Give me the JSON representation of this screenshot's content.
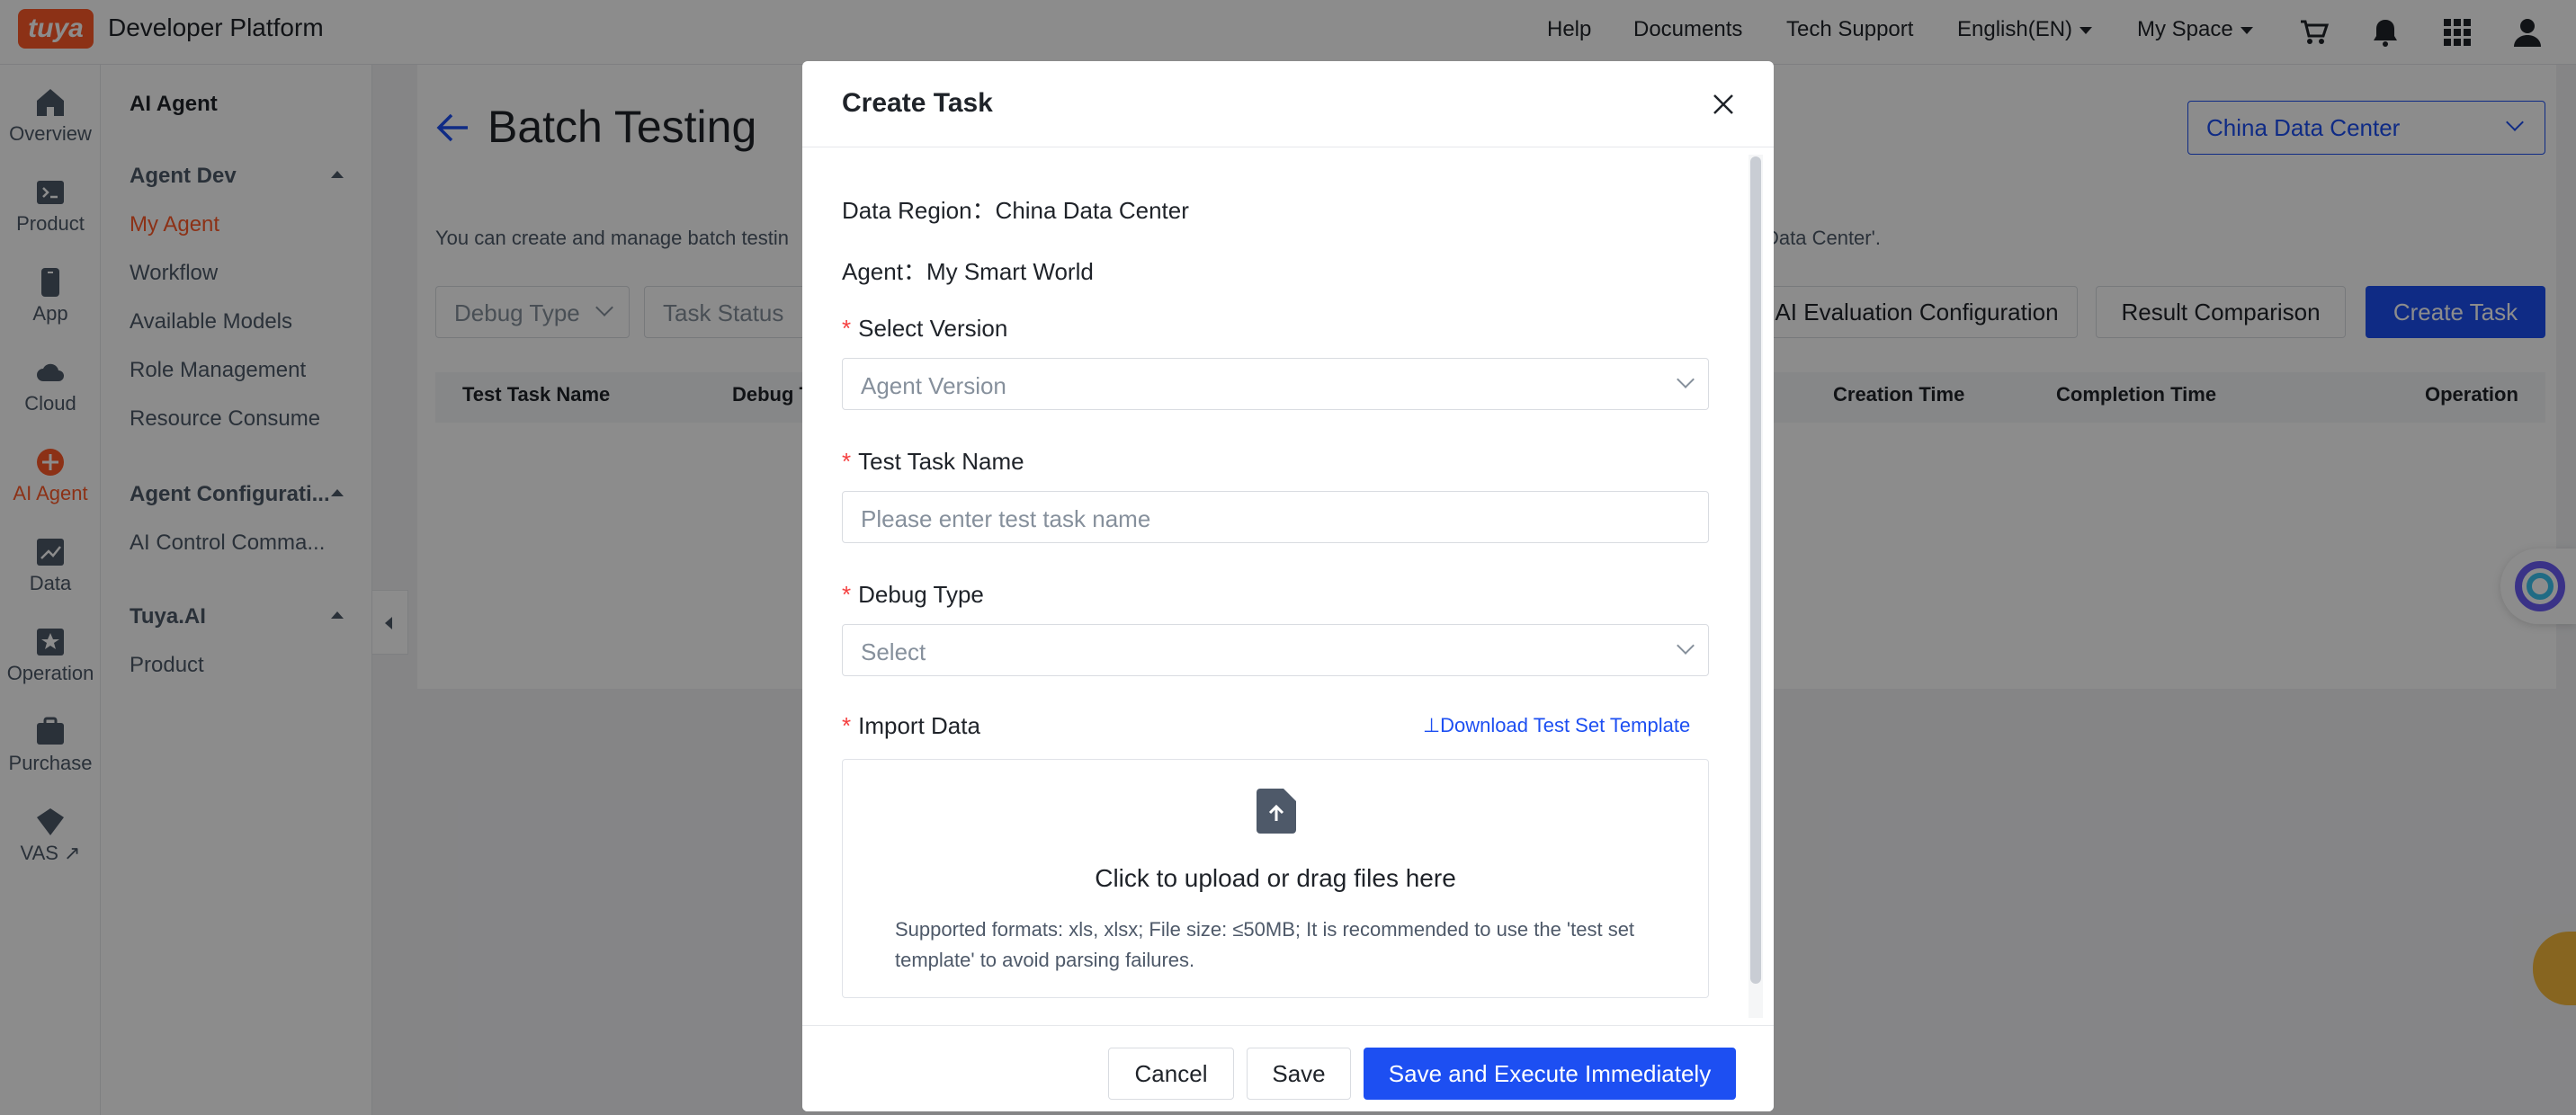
{
  "header": {
    "logo_text": "tuya",
    "brand": "Developer Platform",
    "nav": [
      "Help",
      "Documents",
      "Tech Support"
    ],
    "language": "English(EN)",
    "space": "My Space",
    "icons": [
      "cart-icon",
      "bell-icon",
      "apps-grid-icon",
      "user-icon"
    ]
  },
  "rail": {
    "items": [
      {
        "label": "Overview",
        "icon": "home-icon"
      },
      {
        "label": "Product",
        "icon": "product-icon"
      },
      {
        "label": "App",
        "icon": "app-icon"
      },
      {
        "label": "Cloud",
        "icon": "cloud-icon"
      },
      {
        "label": "AI Agent",
        "icon": "ai-agent-icon",
        "active": true
      },
      {
        "label": "Data",
        "icon": "chart-icon"
      },
      {
        "label": "Operation",
        "icon": "operation-icon"
      },
      {
        "label": "Purchase",
        "icon": "purchase-icon"
      },
      {
        "label": "VAS",
        "icon": "vas-icon"
      }
    ]
  },
  "submenu": {
    "title": "AI Agent",
    "groups": [
      {
        "label": "Agent Dev",
        "items": [
          "My Agent",
          "Workflow",
          "Available Models",
          "Role Management",
          "Resource Consume"
        ]
      },
      {
        "label": "Agent Configurati...",
        "items": [
          "AI Control Comma..."
        ]
      },
      {
        "label": "Tuya.AI",
        "items": [
          "Product"
        ]
      }
    ],
    "active_item": "My Agent"
  },
  "page": {
    "title": "Batch Testing",
    "data_center": "China Data Center",
    "description_left": "You can create and manage batch testin",
    "description_right": "Data Center'.",
    "filters": [
      "Debug Type",
      "Task Status"
    ],
    "buttons": {
      "ai_eval": "AI Evaluation Configuration",
      "compare": "Result Comparison",
      "create": "Create Task"
    },
    "table_headers": [
      "Test Task Name",
      "Debug T",
      "Creation Time",
      "Completion Time",
      "Operation"
    ]
  },
  "modal": {
    "title": "Create Task",
    "data_region_label": "Data Region：",
    "data_region_value": "China Data Center",
    "agent_label": "Agent：",
    "agent_value": "My Smart World",
    "version_label": "Select Version",
    "version_placeholder": "Agent Version",
    "task_name_label": "Test Task Name",
    "task_name_placeholder": "Please enter test task name",
    "debug_type_label": "Debug Type",
    "debug_type_placeholder": "Select",
    "import_label": "Import Data",
    "download_link": "Download Test Set Template",
    "upload_title": "Click to upload or drag files here",
    "upload_hint": "Supported formats: xls, xlsx; File size: ≤50MB; It is recommended to use the 'test set template' to avoid parsing failures.",
    "cancel": "Cancel",
    "save": "Save",
    "save_execute": "Save and Execute Immediately"
  },
  "colors": {
    "brand_orange": "#ff5a28",
    "primary_blue": "#1d4ff2",
    "required_red": "#f53f3f"
  }
}
